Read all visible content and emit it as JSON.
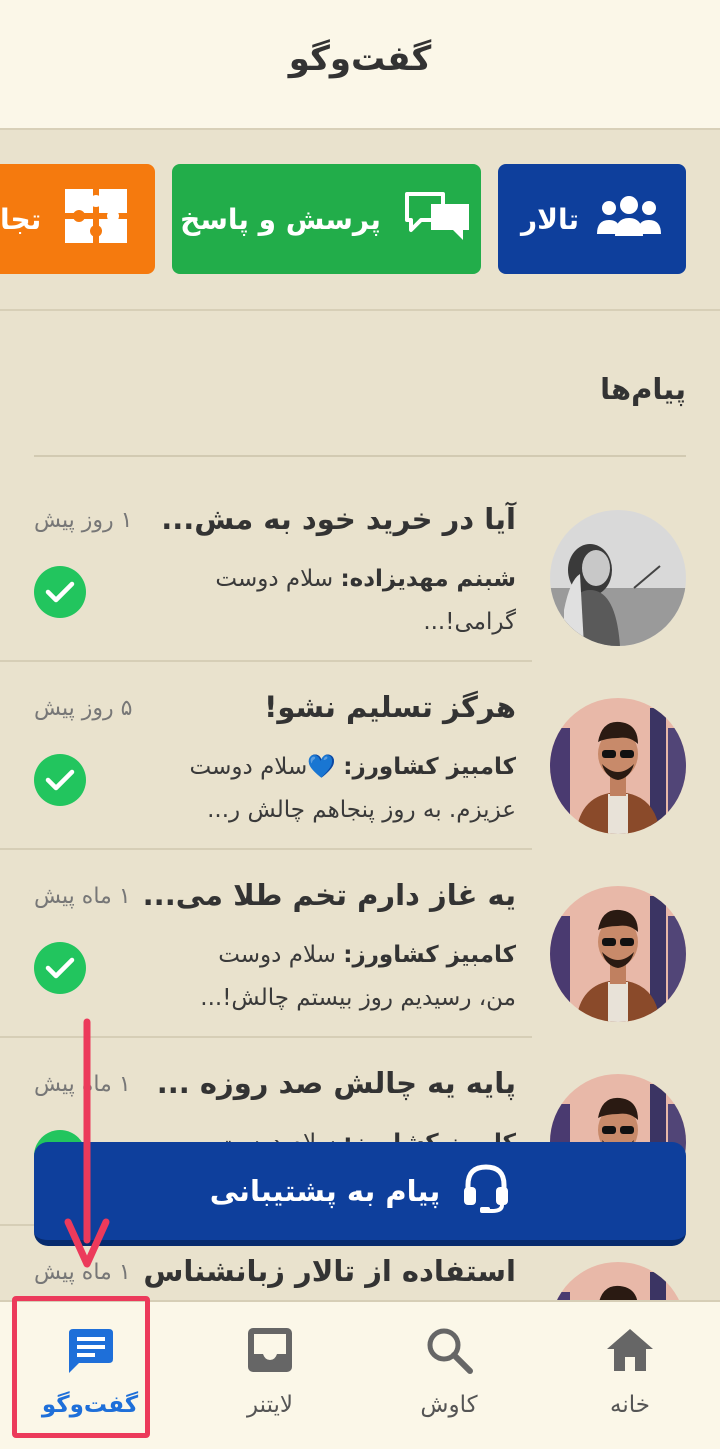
{
  "header": {
    "title": "گفت‌وگو"
  },
  "categories": {
    "forum": {
      "label": "تالار",
      "icon": "group-icon",
      "color": "#0e3f9c"
    },
    "qa": {
      "label": "پرسش و پاسخ",
      "icon": "chat-bubbles-icon",
      "color": "#22ad4a"
    },
    "experiences": {
      "label": "تجا",
      "icon": "puzzle-icon",
      "color": "#f57a0e"
    }
  },
  "messages_section": {
    "title": "پیام‌ها"
  },
  "messages": [
    {
      "title": "آیا در خرید خود به مش...",
      "sender": "شبنم مهدیزاده:",
      "preview": " سلام دوست گرامی!...",
      "time": "۱ روز پیش",
      "status": "read"
    },
    {
      "title": "هرگز تسلیم نشو!",
      "sender": "کامبیز کشاورز:",
      "preview": " 💙سلام دوست عزیزم. به روز پنجاهم چالش ر...",
      "time": "۵ روز پیش",
      "status": "read"
    },
    {
      "title": "یه غاز دارم تخم طلا می...",
      "sender": "کامبیز کشاورز:",
      "preview": " سلام دوست من، رسیدیم روز بیستم چالش!...",
      "time": "۱ ماه پیش",
      "status": "read"
    },
    {
      "title": "پایه یه چالش صد روزه ...",
      "sender": "کامبیز کشاورز:",
      "preview": " سلام دوست",
      "time": "۱ ماه پیش",
      "status": "read"
    },
    {
      "title": "استفاده از تالار زبانشناس",
      "sender": "",
      "preview": "",
      "time": "۱ ماه پیش",
      "status": "read"
    }
  ],
  "support_button": {
    "label": "پیام به پشتیبانی",
    "icon": "headset-icon"
  },
  "bottom_nav": {
    "home": "خانه",
    "search": "کاوش",
    "lightner": "لایتنر",
    "chat": "گفت‌وگو",
    "active": "chat"
  },
  "colors": {
    "accent": "#1e6fd9",
    "annotation": "#ec3a5b",
    "check": "#22c55e",
    "primary": "#0e3f9c"
  }
}
